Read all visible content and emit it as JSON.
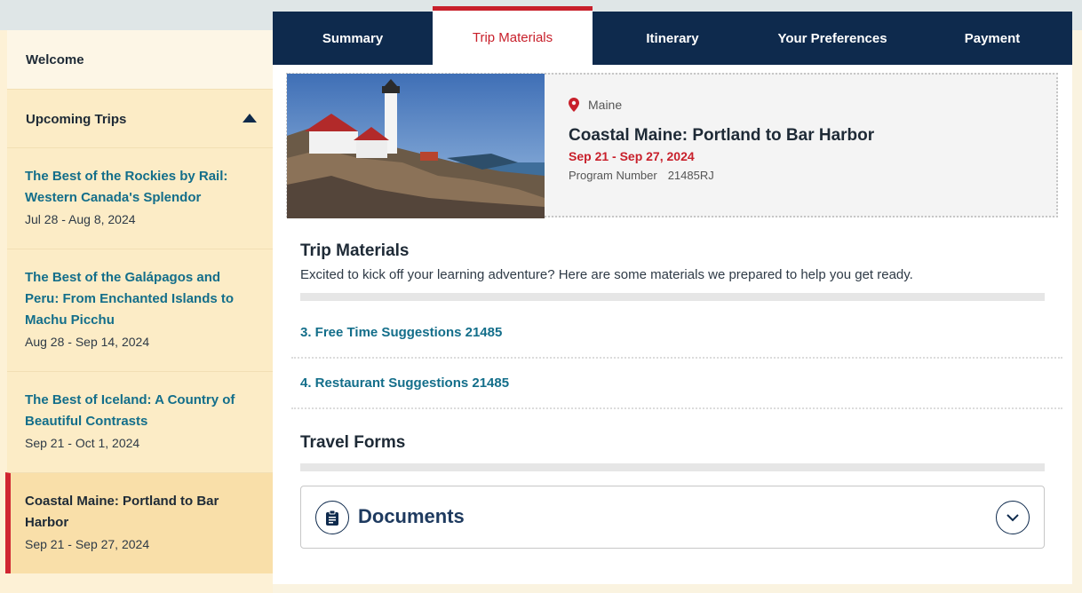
{
  "sidebar": {
    "welcome": "Welcome",
    "upcoming_label": "Upcoming Trips",
    "trips": [
      {
        "title": "The Best of the Rockies by Rail: Western Canada's Splendor",
        "dates": "Jul 28 - Aug 8, 2024"
      },
      {
        "title": "The Best of the Galápagos and Peru: From Enchanted Islands to Machu Picchu",
        "dates": "Aug 28 - Sep 14, 2024"
      },
      {
        "title": "The Best of Iceland: A Country of Beautiful Contrasts",
        "dates": "Sep 21 - Oct 1, 2024"
      },
      {
        "title": "Coastal Maine: Portland to Bar Harbor",
        "dates": "Sep 21 - Sep 27, 2024"
      }
    ]
  },
  "tabs": [
    "Summary",
    "Trip Materials",
    "Itinerary",
    "Your Preferences",
    "Payment"
  ],
  "active_tab": "Trip Materials",
  "trip_card": {
    "location": "Maine",
    "title": "Coastal Maine: Portland to Bar Harbor",
    "dates": "Sep 21 - Sep 27, 2024",
    "program_label": "Program Number",
    "program_number": "21485RJ"
  },
  "trip_materials": {
    "heading": "Trip Materials",
    "description": "Excited to kick off your learning adventure? Here are some materials we prepared to help you get ready.",
    "links": [
      "3. Free Time Suggestions 21485",
      "4. Restaurant Suggestions 21485"
    ]
  },
  "travel_forms": {
    "heading": "Travel Forms",
    "documents_label": "Documents"
  },
  "colors": {
    "navy": "#0e2a4d",
    "accent_red": "#c8202b",
    "link_teal": "#136e8a",
    "sidebar_bg": "#fcecc6",
    "sidebar_active": "#f9dfa9"
  },
  "icons": [
    "caret-up-icon",
    "map-pin-icon",
    "clipboard-icon",
    "chevron-down-icon"
  ]
}
